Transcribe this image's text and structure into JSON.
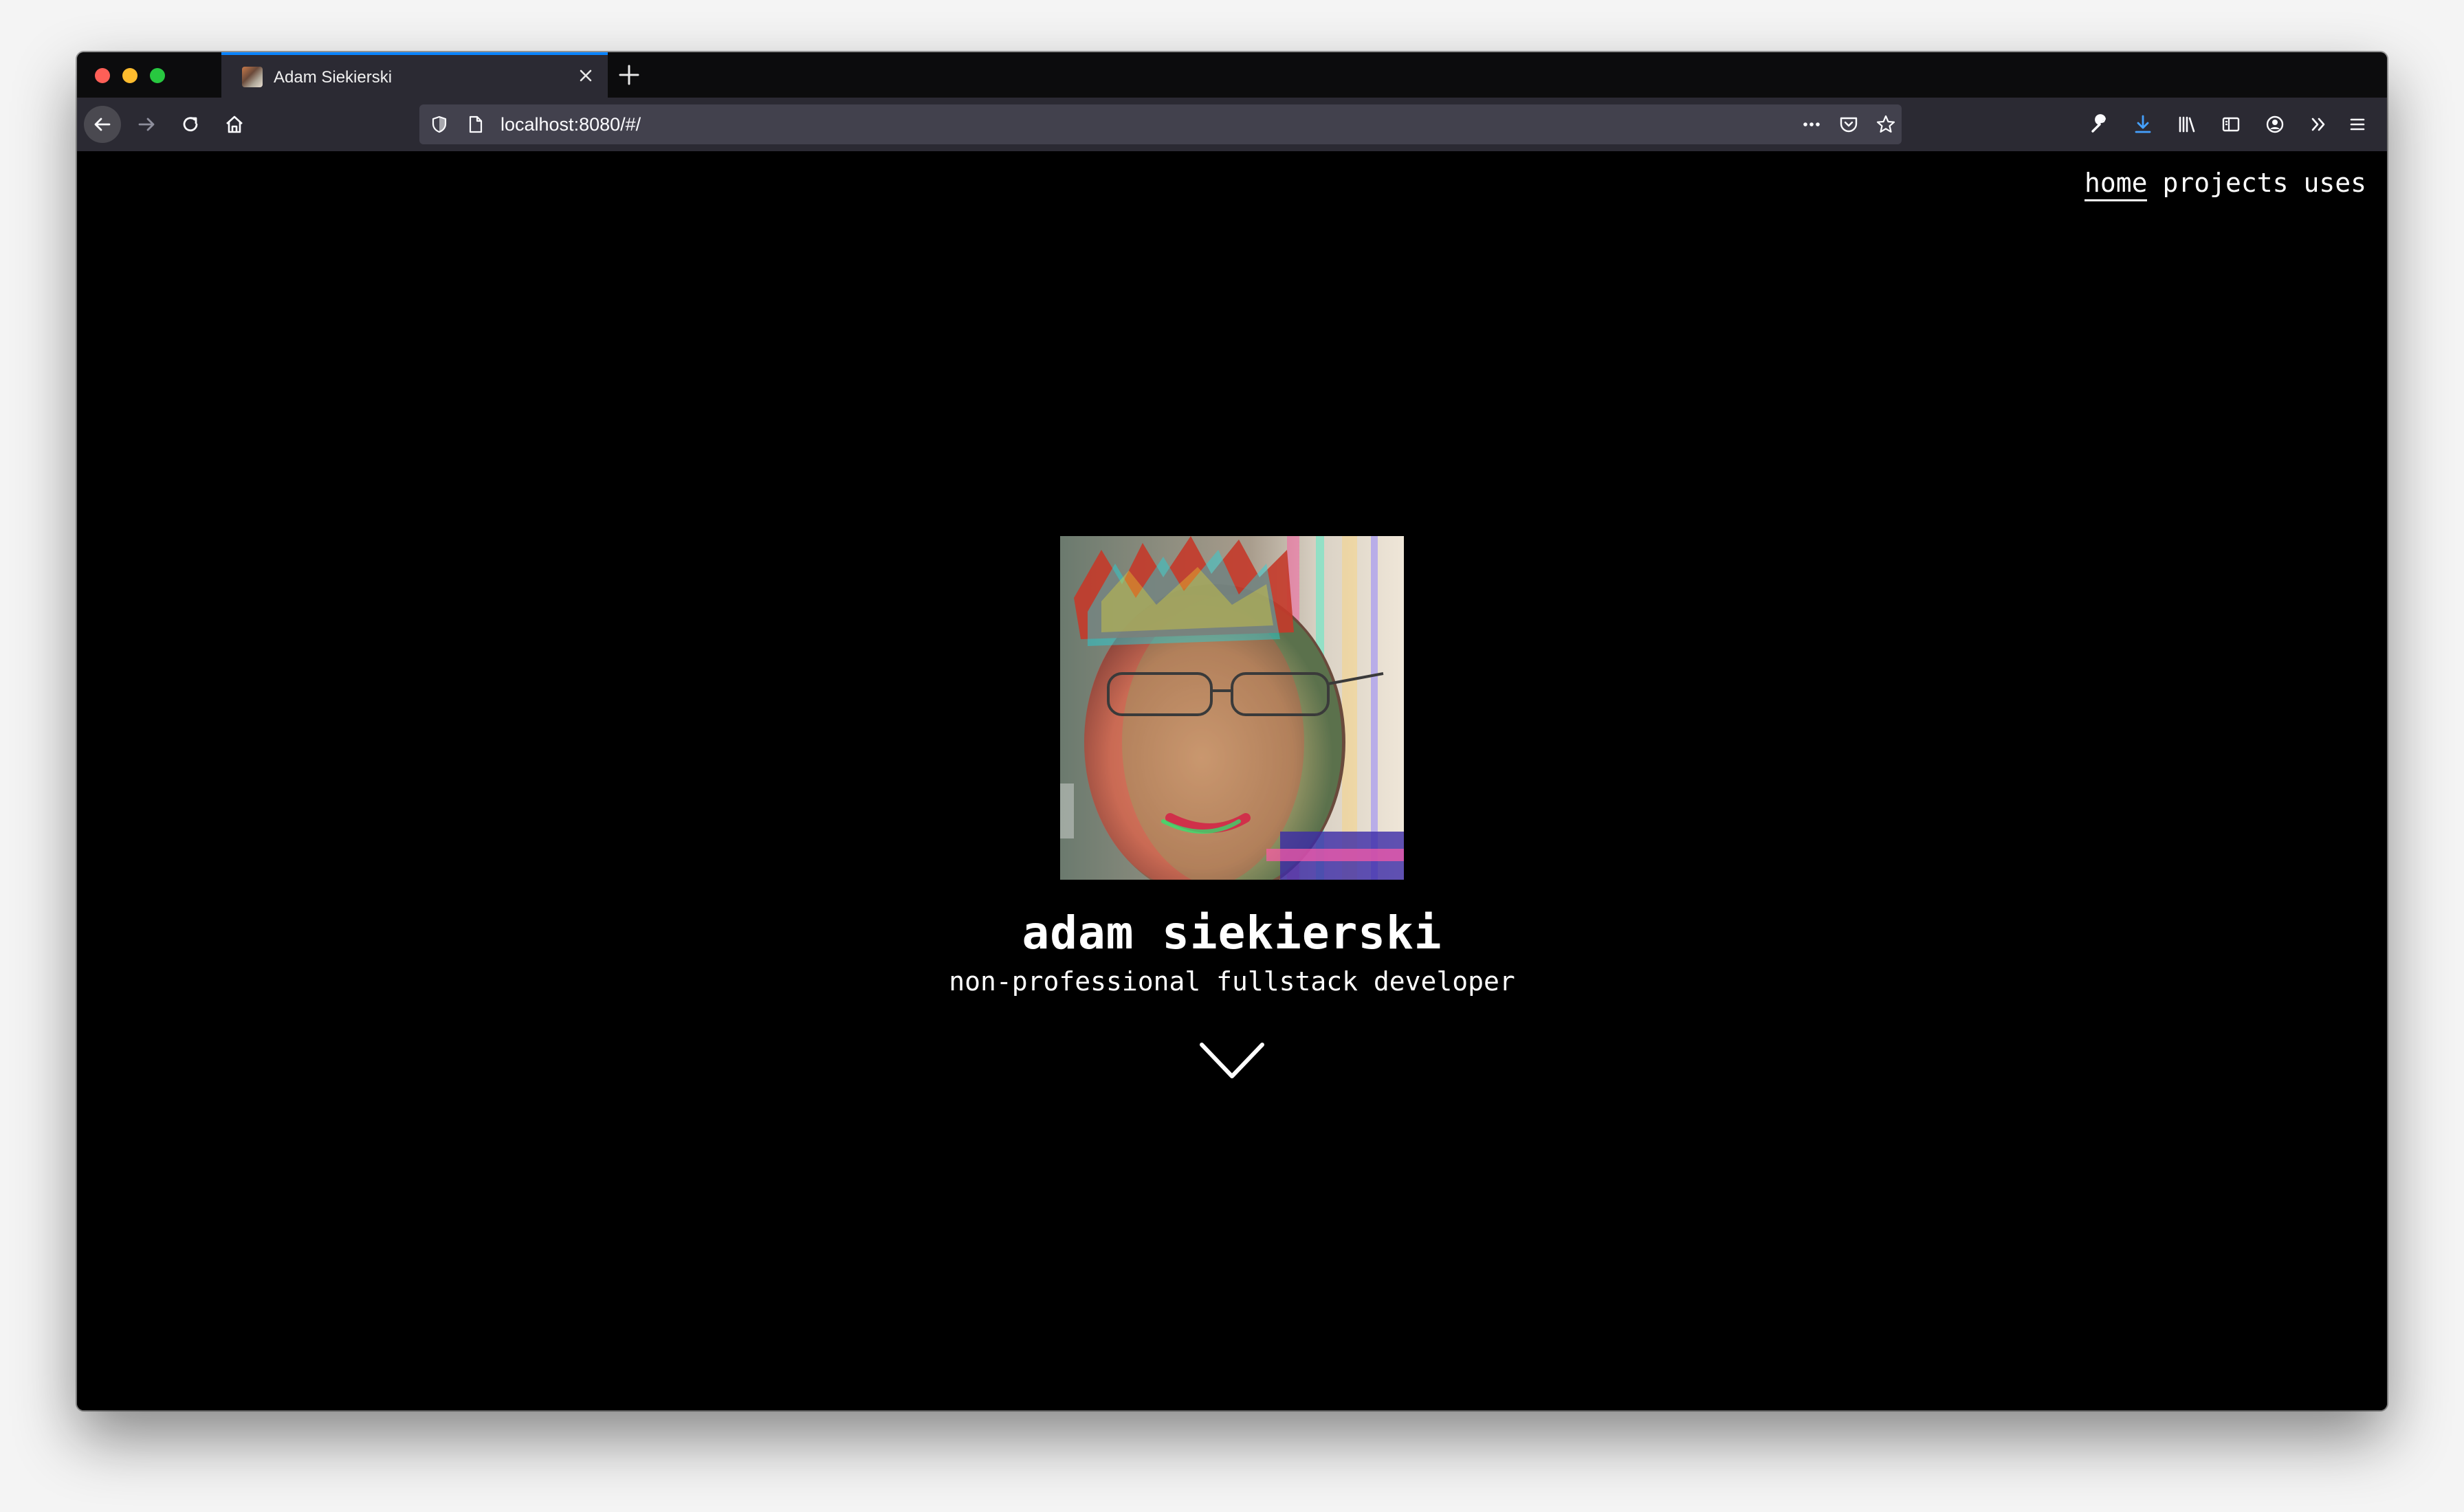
{
  "browser": {
    "tab": {
      "title": "Adam Siekierski"
    },
    "address_bar": {
      "url": "localhost:8080/#/"
    }
  },
  "site": {
    "nav": {
      "items": [
        {
          "label": "home",
          "active": true
        },
        {
          "label": "projects",
          "active": false
        },
        {
          "label": "uses",
          "active": false
        }
      ]
    },
    "hero": {
      "name": "adam siekierski",
      "tagline": "non-professional fullstack developer"
    }
  },
  "colors": {
    "page_background": "#000000",
    "toolbar_background": "#2b2a33",
    "download_icon": "#45a1ff",
    "active_tab_accent": "#0a84ff"
  }
}
